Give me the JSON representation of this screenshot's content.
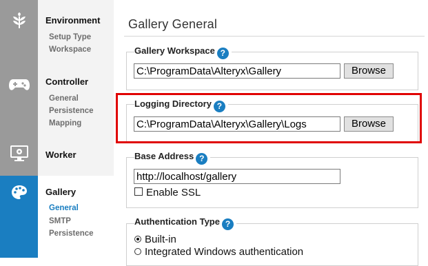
{
  "colors": {
    "accent": "#1a7ec1",
    "highlight": "#e00000",
    "rail": "#9a9a9a"
  },
  "nav": {
    "environment": {
      "icon": "leaf-icon",
      "label": "Environment",
      "items": [
        "Setup Type",
        "Workspace"
      ]
    },
    "controller": {
      "icon": "gamepad-icon",
      "label": "Controller",
      "items": [
        "General",
        "Persistence",
        "Mapping"
      ]
    },
    "worker": {
      "icon": "monitor-gear-icon",
      "label": "Worker",
      "items": []
    },
    "gallery": {
      "icon": "palette-icon",
      "label": "Gallery",
      "items": [
        "General",
        "SMTP",
        "Persistence"
      ],
      "active_item": "General"
    }
  },
  "page": {
    "title": "Gallery General"
  },
  "sections": {
    "workspace": {
      "legend": "Gallery Workspace",
      "value": "C:\\ProgramData\\Alteryx\\Gallery",
      "button": "Browse"
    },
    "logging": {
      "legend": "Logging Directory",
      "value": "C:\\ProgramData\\Alteryx\\Gallery\\Logs",
      "button": "Browse"
    },
    "base_address": {
      "legend": "Base Address",
      "value": "http://localhost/gallery",
      "ssl_label": "Enable SSL",
      "ssl_checked": false
    },
    "auth": {
      "legend": "Authentication Type",
      "options": [
        "Built-in",
        "Integrated Windows authentication"
      ],
      "selected": "Built-in"
    }
  },
  "help_glyph": "?"
}
